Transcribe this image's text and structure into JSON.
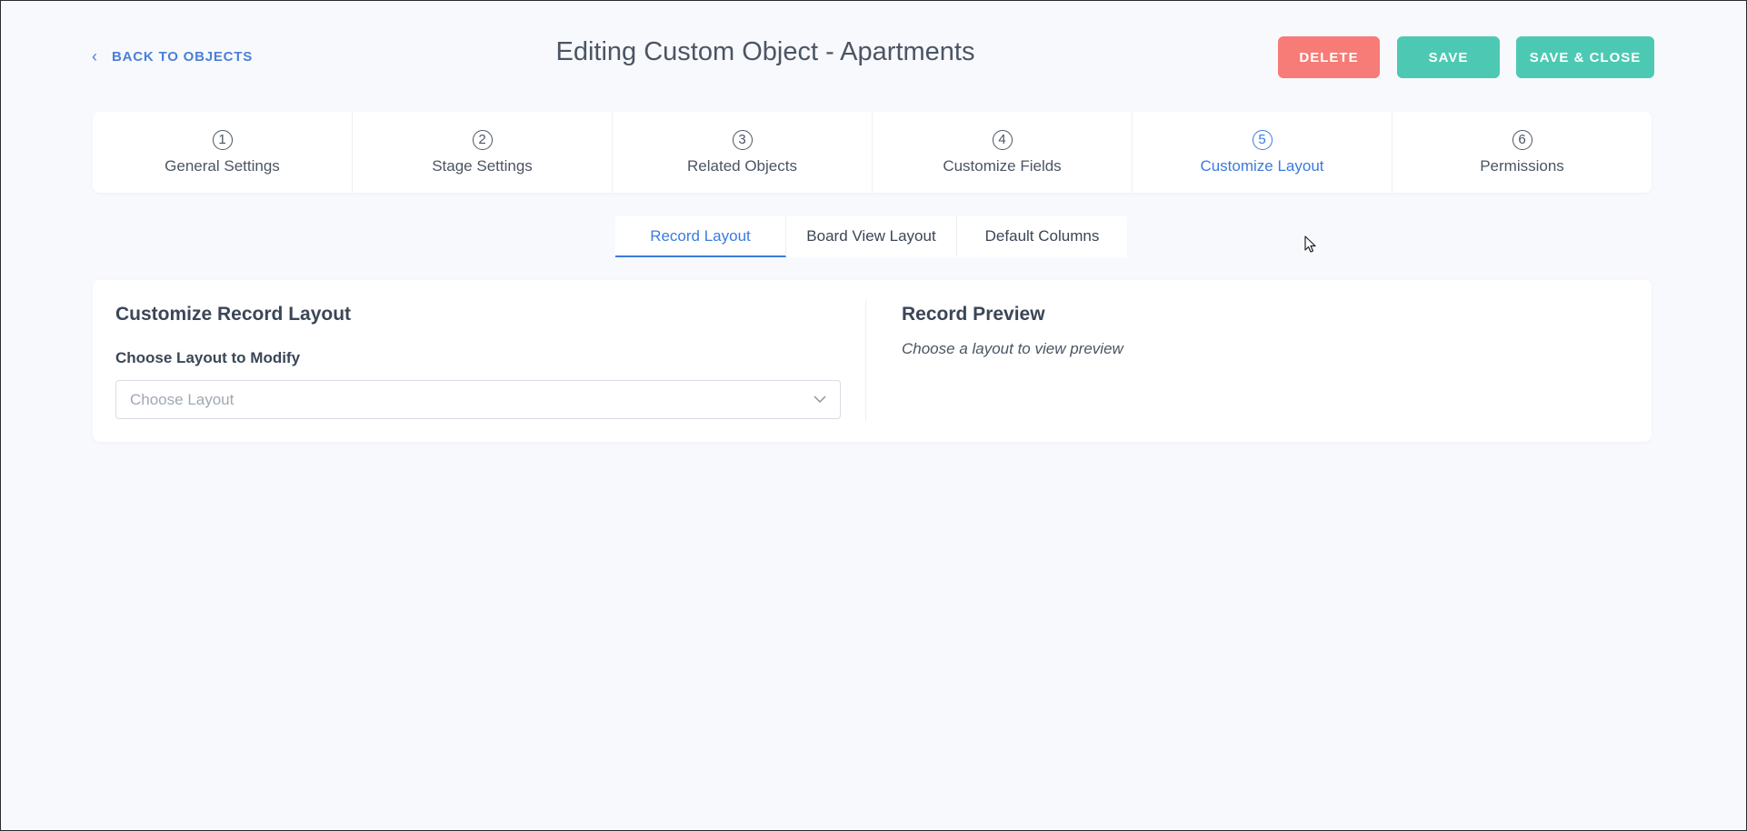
{
  "header": {
    "back_label": "BACK TO OBJECTS",
    "title": "Editing Custom Object - Apartments",
    "delete_label": "DELETE",
    "save_label": "SAVE",
    "save_close_label": "SAVE & CLOSE"
  },
  "steps": [
    {
      "num": "1",
      "label": "General Settings"
    },
    {
      "num": "2",
      "label": "Stage Settings"
    },
    {
      "num": "3",
      "label": "Related Objects"
    },
    {
      "num": "4",
      "label": "Customize Fields"
    },
    {
      "num": "5",
      "label": "Customize Layout"
    },
    {
      "num": "6",
      "label": "Permissions"
    }
  ],
  "active_step": "5",
  "subtabs": {
    "items": [
      "Record Layout",
      "Board View Layout",
      "Default Columns"
    ],
    "active": "Record Layout"
  },
  "record_layout": {
    "title": "Customize Record Layout",
    "field_label": "Choose Layout to Modify",
    "select_placeholder": "Choose Layout"
  },
  "preview": {
    "title": "Record Preview",
    "empty_text": "Choose a layout to view preview"
  },
  "colors": {
    "accent": "#3b7be0",
    "delete": "#f77b76",
    "save": "#4dc9b3",
    "background": "#f8f9fd"
  }
}
